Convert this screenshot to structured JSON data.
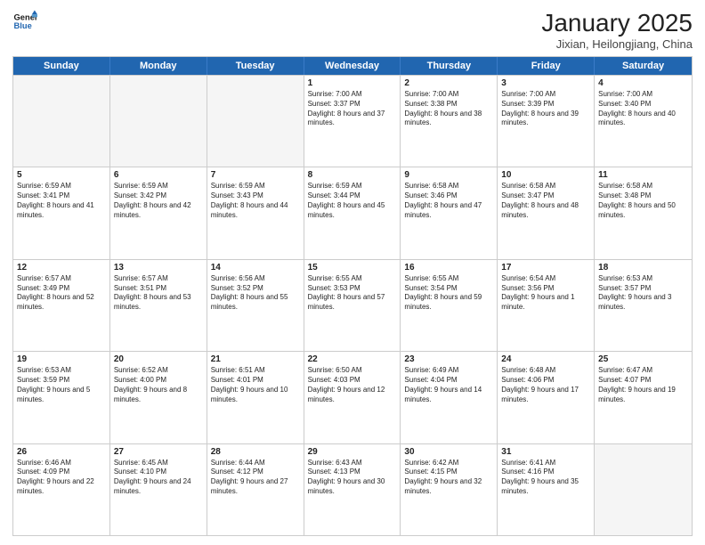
{
  "header": {
    "logo_line1": "General",
    "logo_line2": "Blue",
    "month_title": "January 2025",
    "location": "Jixian, Heilongjiang, China"
  },
  "weekdays": [
    "Sunday",
    "Monday",
    "Tuesday",
    "Wednesday",
    "Thursday",
    "Friday",
    "Saturday"
  ],
  "rows": [
    [
      {
        "day": "",
        "text": ""
      },
      {
        "day": "",
        "text": ""
      },
      {
        "day": "",
        "text": ""
      },
      {
        "day": "1",
        "text": "Sunrise: 7:00 AM\nSunset: 3:37 PM\nDaylight: 8 hours and 37 minutes."
      },
      {
        "day": "2",
        "text": "Sunrise: 7:00 AM\nSunset: 3:38 PM\nDaylight: 8 hours and 38 minutes."
      },
      {
        "day": "3",
        "text": "Sunrise: 7:00 AM\nSunset: 3:39 PM\nDaylight: 8 hours and 39 minutes."
      },
      {
        "day": "4",
        "text": "Sunrise: 7:00 AM\nSunset: 3:40 PM\nDaylight: 8 hours and 40 minutes."
      }
    ],
    [
      {
        "day": "5",
        "text": "Sunrise: 6:59 AM\nSunset: 3:41 PM\nDaylight: 8 hours and 41 minutes."
      },
      {
        "day": "6",
        "text": "Sunrise: 6:59 AM\nSunset: 3:42 PM\nDaylight: 8 hours and 42 minutes."
      },
      {
        "day": "7",
        "text": "Sunrise: 6:59 AM\nSunset: 3:43 PM\nDaylight: 8 hours and 44 minutes."
      },
      {
        "day": "8",
        "text": "Sunrise: 6:59 AM\nSunset: 3:44 PM\nDaylight: 8 hours and 45 minutes."
      },
      {
        "day": "9",
        "text": "Sunrise: 6:58 AM\nSunset: 3:46 PM\nDaylight: 8 hours and 47 minutes."
      },
      {
        "day": "10",
        "text": "Sunrise: 6:58 AM\nSunset: 3:47 PM\nDaylight: 8 hours and 48 minutes."
      },
      {
        "day": "11",
        "text": "Sunrise: 6:58 AM\nSunset: 3:48 PM\nDaylight: 8 hours and 50 minutes."
      }
    ],
    [
      {
        "day": "12",
        "text": "Sunrise: 6:57 AM\nSunset: 3:49 PM\nDaylight: 8 hours and 52 minutes."
      },
      {
        "day": "13",
        "text": "Sunrise: 6:57 AM\nSunset: 3:51 PM\nDaylight: 8 hours and 53 minutes."
      },
      {
        "day": "14",
        "text": "Sunrise: 6:56 AM\nSunset: 3:52 PM\nDaylight: 8 hours and 55 minutes."
      },
      {
        "day": "15",
        "text": "Sunrise: 6:55 AM\nSunset: 3:53 PM\nDaylight: 8 hours and 57 minutes."
      },
      {
        "day": "16",
        "text": "Sunrise: 6:55 AM\nSunset: 3:54 PM\nDaylight: 8 hours and 59 minutes."
      },
      {
        "day": "17",
        "text": "Sunrise: 6:54 AM\nSunset: 3:56 PM\nDaylight: 9 hours and 1 minute."
      },
      {
        "day": "18",
        "text": "Sunrise: 6:53 AM\nSunset: 3:57 PM\nDaylight: 9 hours and 3 minutes."
      }
    ],
    [
      {
        "day": "19",
        "text": "Sunrise: 6:53 AM\nSunset: 3:59 PM\nDaylight: 9 hours and 5 minutes."
      },
      {
        "day": "20",
        "text": "Sunrise: 6:52 AM\nSunset: 4:00 PM\nDaylight: 9 hours and 8 minutes."
      },
      {
        "day": "21",
        "text": "Sunrise: 6:51 AM\nSunset: 4:01 PM\nDaylight: 9 hours and 10 minutes."
      },
      {
        "day": "22",
        "text": "Sunrise: 6:50 AM\nSunset: 4:03 PM\nDaylight: 9 hours and 12 minutes."
      },
      {
        "day": "23",
        "text": "Sunrise: 6:49 AM\nSunset: 4:04 PM\nDaylight: 9 hours and 14 minutes."
      },
      {
        "day": "24",
        "text": "Sunrise: 6:48 AM\nSunset: 4:06 PM\nDaylight: 9 hours and 17 minutes."
      },
      {
        "day": "25",
        "text": "Sunrise: 6:47 AM\nSunset: 4:07 PM\nDaylight: 9 hours and 19 minutes."
      }
    ],
    [
      {
        "day": "26",
        "text": "Sunrise: 6:46 AM\nSunset: 4:09 PM\nDaylight: 9 hours and 22 minutes."
      },
      {
        "day": "27",
        "text": "Sunrise: 6:45 AM\nSunset: 4:10 PM\nDaylight: 9 hours and 24 minutes."
      },
      {
        "day": "28",
        "text": "Sunrise: 6:44 AM\nSunset: 4:12 PM\nDaylight: 9 hours and 27 minutes."
      },
      {
        "day": "29",
        "text": "Sunrise: 6:43 AM\nSunset: 4:13 PM\nDaylight: 9 hours and 30 minutes."
      },
      {
        "day": "30",
        "text": "Sunrise: 6:42 AM\nSunset: 4:15 PM\nDaylight: 9 hours and 32 minutes."
      },
      {
        "day": "31",
        "text": "Sunrise: 6:41 AM\nSunset: 4:16 PM\nDaylight: 9 hours and 35 minutes."
      },
      {
        "day": "",
        "text": ""
      }
    ]
  ]
}
